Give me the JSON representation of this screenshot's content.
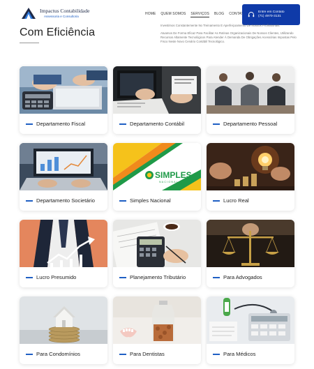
{
  "header": {
    "logo_name": "Impactus Contabilidade",
    "logo_sub": "Assessoria e Consultoria",
    "nav": [
      {
        "label": "HOME",
        "active": false
      },
      {
        "label": "QUEM SOMOS",
        "active": false
      },
      {
        "label": "SERVIÇOS",
        "active": true
      },
      {
        "label": "BLOG",
        "active": false
      },
      {
        "label": "CONTATOS",
        "active": false
      }
    ],
    "cta": {
      "label": "Entre em Contato",
      "phone": "(71) 4970-3131",
      "icon": "headset-icon"
    }
  },
  "hero": {
    "title": "Com Eficiência",
    "paragraph_1": "Investimos Constantemente No Treinamento E Aperfeiçoamento De Nossos Profissionais.",
    "paragraph_2": "Atuamos De Forma Eficaz Para Facilitar As Rotinas Organizacionais De Nossos Clientes, Utilizando Recursos Altamente Tecnológicos Para Atender À Demanda De Obrigações Acessórias Impostas Pelo Fisco Neste Novo Cenário Contábil Tecnológico."
  },
  "services": [
    {
      "label": "Departamento Fiscal",
      "image": "calculator-laptop"
    },
    {
      "label": "Departamento Contábil",
      "image": "laptop-documents"
    },
    {
      "label": "Departamento Pessoal",
      "image": "business-meeting"
    },
    {
      "label": "Departamento Societário",
      "image": "laptop-charts"
    },
    {
      "label": "Simples Nacional",
      "image": "simples-nacional-logo",
      "logo_text": "SIMPLES",
      "logo_sub": "NACIONAL"
    },
    {
      "label": "Lucro Real",
      "image": "lightbulb-coins"
    },
    {
      "label": "Lucro Presumido",
      "image": "growth-arrow"
    },
    {
      "label": "Planejamento Tributário",
      "image": "calculator-coffee"
    },
    {
      "label": "Para Advogados",
      "image": "justice-scale"
    },
    {
      "label": "Para Condomínios",
      "image": "house-coins"
    },
    {
      "label": "Para Dentistas",
      "image": "coin-jar"
    },
    {
      "label": "Para Médicos",
      "image": "stethoscope-calculator"
    }
  ],
  "colors": {
    "accent": "#1f5fc4",
    "cta_bg": "#0f3aa8",
    "logo_dark": "#1f2a48"
  }
}
